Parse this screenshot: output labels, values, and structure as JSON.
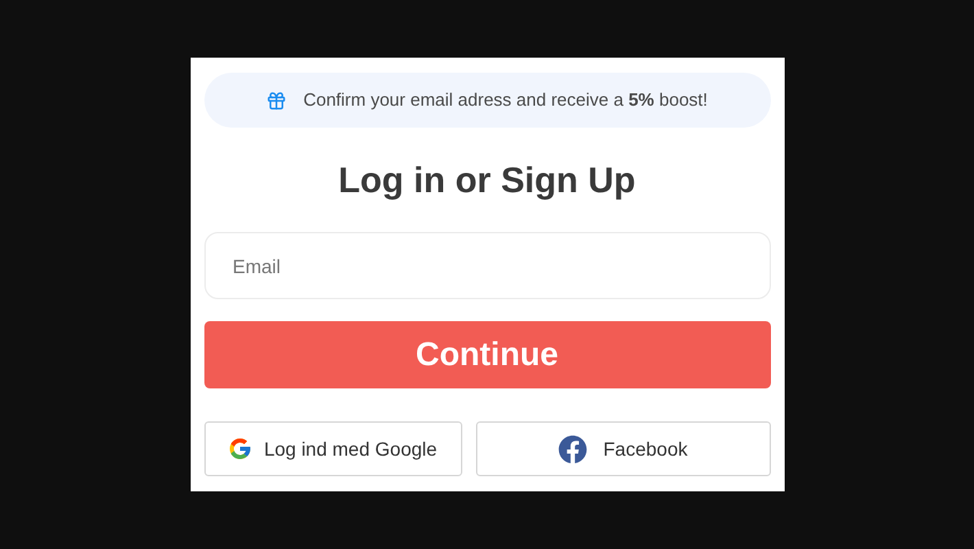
{
  "banner": {
    "text": "Confirm your email adress and receive a **5%** boost!"
  },
  "title": "Log in or Sign Up",
  "email": {
    "placeholder": "Email"
  },
  "continue_button": "Continue",
  "social_buttons": [
    {
      "kind": "google",
      "label": "Log ind med Google"
    },
    {
      "kind": "facebook",
      "label": "Facebook"
    }
  ]
}
